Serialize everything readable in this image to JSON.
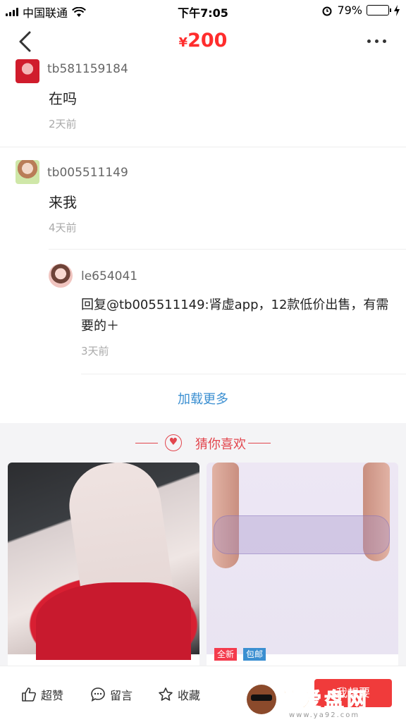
{
  "status_bar": {
    "carrier": "中国联通",
    "time": "下午7:05",
    "battery": "79%",
    "battery_level": 0.79
  },
  "nav": {
    "currency": "¥",
    "price": "200"
  },
  "comments": [
    {
      "user": "tb581159184",
      "text": "在吗",
      "time": "2天前"
    },
    {
      "user": "tb005511149",
      "text": "来我",
      "time": "4天前"
    }
  ],
  "reply": {
    "user": "le654041",
    "text": "回复@tb005511149:肾虚app，12款低价出售，有需要的＋",
    "time": "3天前"
  },
  "load_more": "加载更多",
  "recommend": {
    "title": "猜你喜欢",
    "tag_new": "全新",
    "tag_post": "包邮"
  },
  "bottom_bar": {
    "like": "超赞",
    "comment": "留言",
    "favorite": "收藏",
    "want": "我想要"
  },
  "watermark": {
    "text": "就爱盘网",
    "url": "www.ya92.com"
  },
  "colors": {
    "price_red": "#ff2d2d",
    "link_blue": "#3b8fd1",
    "accent_red": "#e2454d"
  }
}
